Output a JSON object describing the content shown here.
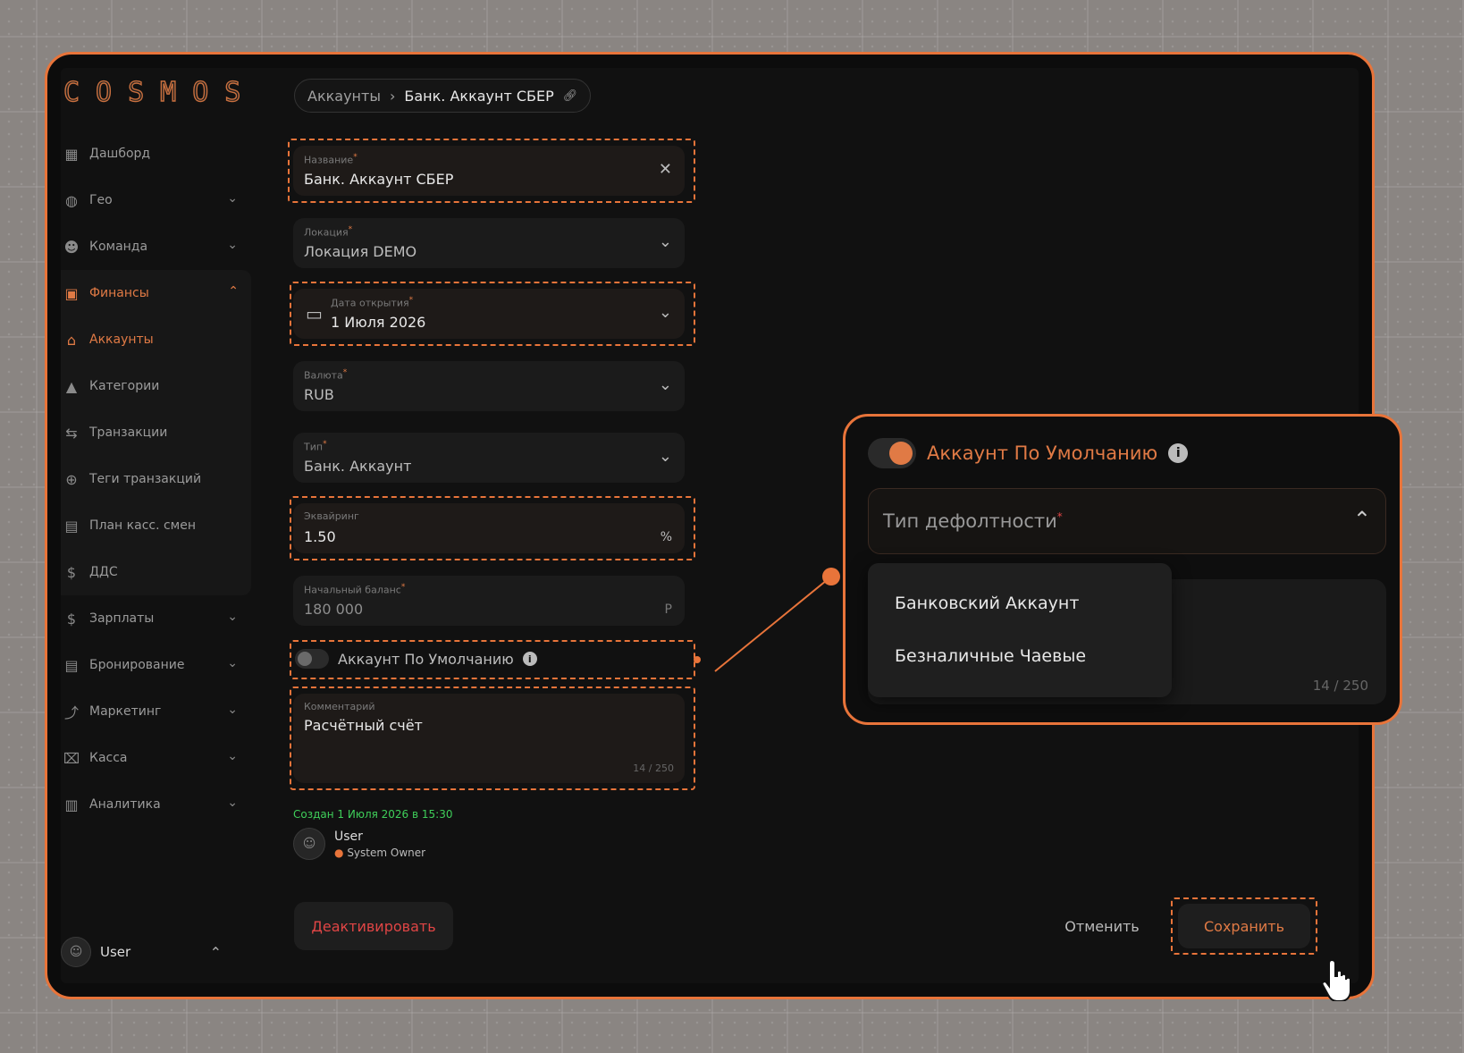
{
  "app": {
    "logo": "COSMOS"
  },
  "sidebar": {
    "items": [
      {
        "label": "Дашборд",
        "icon": "dashboard-icon",
        "glyph": "▦"
      },
      {
        "label": "Гео",
        "icon": "globe-icon",
        "glyph": "◍"
      },
      {
        "label": "Команда",
        "icon": "team-icon",
        "glyph": "☻"
      },
      {
        "label": "Финансы",
        "icon": "finance-icon",
        "glyph": "▣"
      },
      {
        "label": "Аккаунты",
        "icon": "bank-icon",
        "glyph": "⌂"
      },
      {
        "label": "Категории",
        "icon": "shapes-icon",
        "glyph": "▲"
      },
      {
        "label": "Транзакции",
        "icon": "arrows-icon",
        "glyph": "⇆"
      },
      {
        "label": "Теги транзакций",
        "icon": "tag-icon",
        "glyph": "⊕"
      },
      {
        "label": "План касс. смен",
        "icon": "calendar-icon",
        "glyph": "▤"
      },
      {
        "label": "ДДС",
        "icon": "dollar-icon",
        "glyph": "$"
      },
      {
        "label": "Зарплаты",
        "icon": "salary-icon",
        "glyph": "$"
      },
      {
        "label": "Бронирование",
        "icon": "booking-icon",
        "glyph": "▤"
      },
      {
        "label": "Маркетинг",
        "icon": "marketing-icon",
        "glyph": "⤴"
      },
      {
        "label": "Касса",
        "icon": "register-icon",
        "glyph": "⌧"
      },
      {
        "label": "Аналитика",
        "icon": "analytics-icon",
        "glyph": "▥"
      }
    ],
    "user": "User"
  },
  "breadcrumb": {
    "parent": "Аккаунты",
    "current": "Банк. Аккаунт СБЕР"
  },
  "form": {
    "name": {
      "label": "Название",
      "value": "Банк. Аккаунт СБЕР"
    },
    "location": {
      "label": "Локация",
      "value": "Локация DEMO"
    },
    "open_date": {
      "label": "Дата открытия",
      "value": "1 Июля 2026"
    },
    "currency": {
      "label": "Валюта",
      "value": "RUB"
    },
    "type": {
      "label": "Тип",
      "value": "Банк. Аккаунт"
    },
    "acquiring": {
      "label": "Эквайринг",
      "value": "1.50",
      "unit": "%"
    },
    "balance": {
      "label": "Начальный баланс",
      "value": "180 000",
      "unit": "Р"
    },
    "default_toggle": {
      "label": "Аккаунт По Умолчанию"
    },
    "comment": {
      "label": "Комментарий",
      "value": "Расчётный счёт",
      "counter": "14 / 250"
    }
  },
  "meta": {
    "created": "Создан 1 Июля 2026 в 15:30",
    "user": "User",
    "role": "System Owner"
  },
  "buttons": {
    "deactivate": "Деактивировать",
    "cancel": "Отменить",
    "save": "Сохранить"
  },
  "popup": {
    "toggle_label": "Аккаунт По Умолчанию",
    "select_placeholder": "Тип дефолтности",
    "options": [
      "Банковский Аккаунт",
      "Безналичные Чаевые"
    ],
    "counter": "14 / 250"
  },
  "colors": {
    "accent": "#e8743a",
    "danger": "#e04545",
    "success": "#3fcf5a"
  }
}
